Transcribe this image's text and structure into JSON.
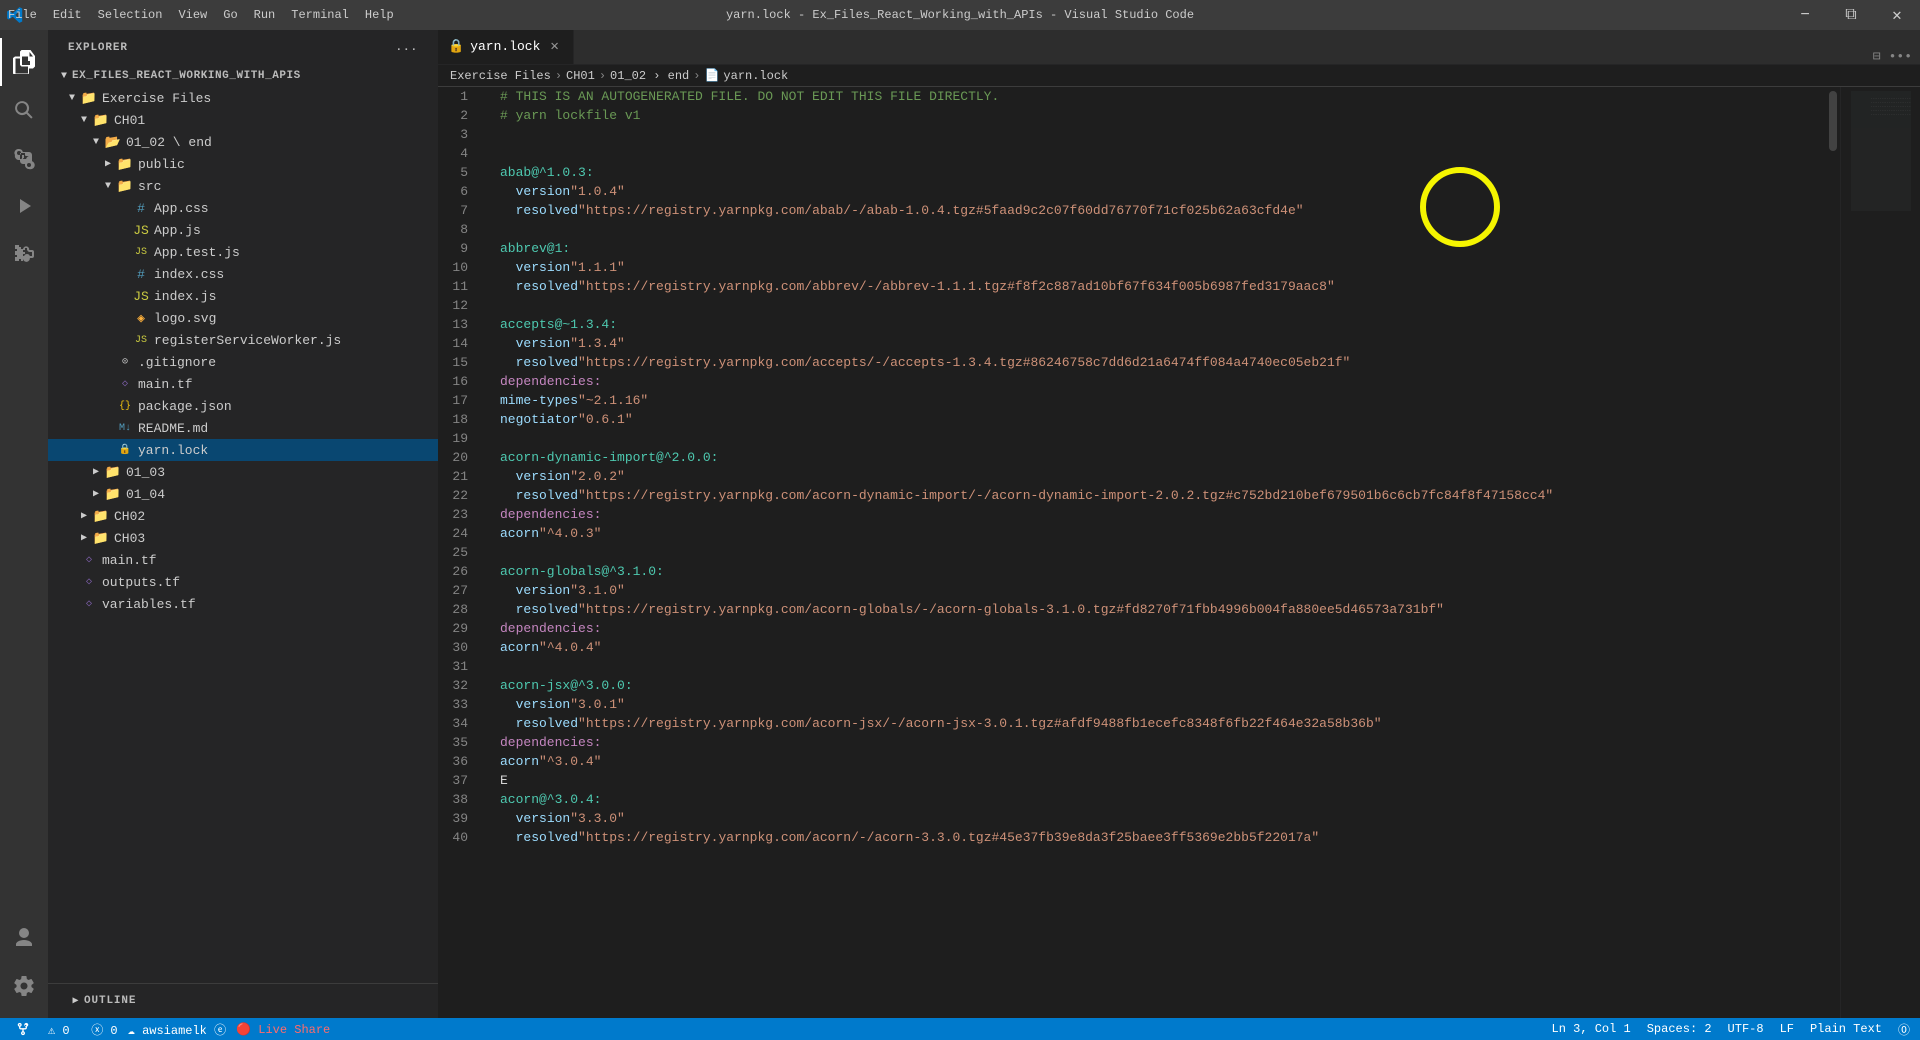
{
  "titleBar": {
    "title": "yarn.lock - Ex_Files_React_Working_with_APIs - Visual Studio Code",
    "menu": [
      "File",
      "Edit",
      "Selection",
      "View",
      "Go",
      "Run",
      "Terminal",
      "Help"
    ],
    "controls": [
      "⊟",
      "❐",
      "✕"
    ]
  },
  "activityBar": {
    "icons": [
      {
        "name": "explorer-icon",
        "symbol": "⎘",
        "active": true
      },
      {
        "name": "search-icon",
        "symbol": "🔍"
      },
      {
        "name": "source-control-icon",
        "symbol": "⎇"
      },
      {
        "name": "run-icon",
        "symbol": "▶"
      },
      {
        "name": "extensions-icon",
        "symbol": "⧉"
      }
    ],
    "bottomIcons": [
      {
        "name": "account-icon",
        "symbol": "◯"
      },
      {
        "name": "settings-icon",
        "symbol": "⚙"
      }
    ]
  },
  "sidebar": {
    "header": "Explorer",
    "headerActions": "...",
    "tree": {
      "root": "EX_FILES_REACT_WORKING_WITH_APIS",
      "items": [
        {
          "label": "Exercise Files",
          "indent": 0,
          "type": "folder",
          "expanded": true
        },
        {
          "label": "CH01",
          "indent": 1,
          "type": "folder",
          "expanded": true
        },
        {
          "label": "01_02  end",
          "indent": 2,
          "type": "folder",
          "expanded": true
        },
        {
          "label": "public",
          "indent": 3,
          "type": "folder",
          "expanded": false
        },
        {
          "label": "src",
          "indent": 3,
          "type": "folder",
          "expanded": true
        },
        {
          "label": "App.css",
          "indent": 4,
          "type": "css"
        },
        {
          "label": "App.js",
          "indent": 4,
          "type": "js"
        },
        {
          "label": "App.test.js",
          "indent": 4,
          "type": "testjs"
        },
        {
          "label": "index.css",
          "indent": 4,
          "type": "css"
        },
        {
          "label": "index.js",
          "indent": 4,
          "type": "js"
        },
        {
          "label": "logo.svg",
          "indent": 4,
          "type": "svg"
        },
        {
          "label": "registerServiceWorker.js",
          "indent": 4,
          "type": "js"
        },
        {
          "label": ".gitignore",
          "indent": 3,
          "type": "gitignore"
        },
        {
          "label": "main.tf",
          "indent": 3,
          "type": "tf"
        },
        {
          "label": "package.json",
          "indent": 3,
          "type": "json"
        },
        {
          "label": "README.md",
          "indent": 3,
          "type": "md"
        },
        {
          "label": "yarn.lock",
          "indent": 3,
          "type": "yarn",
          "selected": true
        },
        {
          "label": "01_03",
          "indent": 2,
          "type": "folder",
          "expanded": false
        },
        {
          "label": "01_04",
          "indent": 2,
          "type": "folder",
          "expanded": false
        },
        {
          "label": "CH02",
          "indent": 1,
          "type": "folder",
          "expanded": false
        },
        {
          "label": "CH03",
          "indent": 1,
          "type": "folder",
          "expanded": false
        },
        {
          "label": "main.tf",
          "indent": 1,
          "type": "tf"
        },
        {
          "label": "outputs.tf",
          "indent": 1,
          "type": "tf"
        },
        {
          "label": "variables.tf",
          "indent": 1,
          "type": "tf"
        }
      ]
    },
    "outline": "OUTLINE"
  },
  "tabs": [
    {
      "label": "yarn.lock",
      "active": true,
      "type": "yarn"
    }
  ],
  "breadcrumb": {
    "items": [
      "Exercise Files",
      "CH01",
      "01_02  end",
      "yarn.lock"
    ],
    "separator": "›",
    "fileIcon": "📄"
  },
  "code": {
    "lines": [
      {
        "num": 1,
        "text": "# THIS IS AN AUTOGENERATED FILE. DO NOT EDIT THIS FILE DIRECTLY.",
        "type": "comment"
      },
      {
        "num": 2,
        "text": "# yarn lockfile v1",
        "type": "comment"
      },
      {
        "num": 3,
        "text": "",
        "type": "empty"
      },
      {
        "num": 4,
        "text": "",
        "type": "empty"
      },
      {
        "num": 5,
        "text": "abab@^1.0.3:",
        "type": "entry"
      },
      {
        "num": 6,
        "text": "  version \"1.0.4\"",
        "type": "kv"
      },
      {
        "num": 7,
        "text": "  resolved \"https://registry.yarnpkg.com/abab/-/abab-1.0.4.tgz#5faad9c2c07f60dd76770f71cf025b62a63cfd4e\"",
        "type": "kv"
      },
      {
        "num": 8,
        "text": "",
        "type": "empty"
      },
      {
        "num": 9,
        "text": "abbrev@1:",
        "type": "entry"
      },
      {
        "num": 10,
        "text": "  version \"1.1.1\"",
        "type": "kv"
      },
      {
        "num": 11,
        "text": "  resolved \"https://registry.yarnpkg.com/abbrev/-/abbrev-1.1.1.tgz#f8f2c887ad10bf67f634f005b6987fed3179aac8\"",
        "type": "kv"
      },
      {
        "num": 12,
        "text": "",
        "type": "empty"
      },
      {
        "num": 13,
        "text": "accepts@~1.3.4:",
        "type": "entry"
      },
      {
        "num": 14,
        "text": "  version \"1.3.4\"",
        "type": "kv"
      },
      {
        "num": 15,
        "text": "  resolved \"https://registry.yarnpkg.com/accepts/-/accepts-1.3.4.tgz#86246758c7dd6d21a6474ff084a4740ec05eb21f\"",
        "type": "kv"
      },
      {
        "num": 16,
        "text": "  dependencies:",
        "type": "dep-header"
      },
      {
        "num": 17,
        "text": "    mime-types \"~2.1.16\"",
        "type": "dep-item"
      },
      {
        "num": 18,
        "text": "    negotiator \"0.6.1\"",
        "type": "dep-item"
      },
      {
        "num": 19,
        "text": "",
        "type": "empty"
      },
      {
        "num": 20,
        "text": "acorn-dynamic-import@^2.0.0:",
        "type": "entry"
      },
      {
        "num": 21,
        "text": "  version \"2.0.2\"",
        "type": "kv"
      },
      {
        "num": 22,
        "text": "  resolved \"https://registry.yarnpkg.com/acorn-dynamic-import/-/acorn-dynamic-import-2.0.2.tgz#c752bd210bef679501b6c6cb7fc84f8f47158cc4\"",
        "type": "kv"
      },
      {
        "num": 23,
        "text": "  dependencies:",
        "type": "dep-header"
      },
      {
        "num": 24,
        "text": "    acorn \"^4.0.3\"",
        "type": "dep-item"
      },
      {
        "num": 25,
        "text": "",
        "type": "empty"
      },
      {
        "num": 26,
        "text": "acorn-globals@^3.1.0:",
        "type": "entry"
      },
      {
        "num": 27,
        "text": "  version \"3.1.0\"",
        "type": "kv"
      },
      {
        "num": 28,
        "text": "  resolved \"https://registry.yarnpkg.com/acorn-globals/-/acorn-globals-3.1.0.tgz#fd8270f71fbb4996b004fa880ee5d46573a731bf\"",
        "type": "kv"
      },
      {
        "num": 29,
        "text": "  dependencies:",
        "type": "dep-header"
      },
      {
        "num": 30,
        "text": "    acorn \"^4.0.4\"",
        "type": "dep-item"
      },
      {
        "num": 31,
        "text": "",
        "type": "empty"
      },
      {
        "num": 32,
        "text": "acorn-jsx@^3.0.0:",
        "type": "entry"
      },
      {
        "num": 33,
        "text": "  version \"3.0.1\"",
        "type": "kv"
      },
      {
        "num": 34,
        "text": "  resolved \"https://registry.yarnpkg.com/acorn-jsx/-/acorn-jsx-3.0.1.tgz#afdf9488fb1ecefc8348f6fb22f464e32a58b36b\"",
        "type": "kv"
      },
      {
        "num": 35,
        "text": "  dependencies:",
        "type": "dep-header"
      },
      {
        "num": 36,
        "text": "    acorn \"^3.0.4\"",
        "type": "dep-item"
      },
      {
        "num": 37,
        "text": "E",
        "type": "plain"
      },
      {
        "num": 38,
        "text": "acorn@^3.0.4:",
        "type": "entry"
      },
      {
        "num": 39,
        "text": "  version \"3.3.0\"",
        "type": "kv"
      },
      {
        "num": 40,
        "text": "  resolved \"https://registry.yarnpkg.com/acorn/-/acorn-3.3.0.tgz#45e37fb39e8da3f25baee3ff5369e2bb5f22017a\"",
        "type": "kv"
      }
    ]
  },
  "statusBar": {
    "left": [
      {
        "label": "⚠ 0  ⓧ 0",
        "name": "errors-warnings"
      },
      {
        "label": "☁ awsiamelk ⓔ",
        "name": "git-status"
      },
      {
        "label": "🔴 Live Share",
        "name": "live-share"
      }
    ],
    "right": [
      {
        "label": "Ln 3, Col 1",
        "name": "cursor-position"
      },
      {
        "label": "Spaces: 2",
        "name": "indentation"
      },
      {
        "label": "UTF-8",
        "name": "encoding"
      },
      {
        "label": "LF",
        "name": "line-ending"
      },
      {
        "label": "Plain Text",
        "name": "language-mode"
      },
      {
        "label": "⓪",
        "name": "feedback"
      }
    ]
  }
}
